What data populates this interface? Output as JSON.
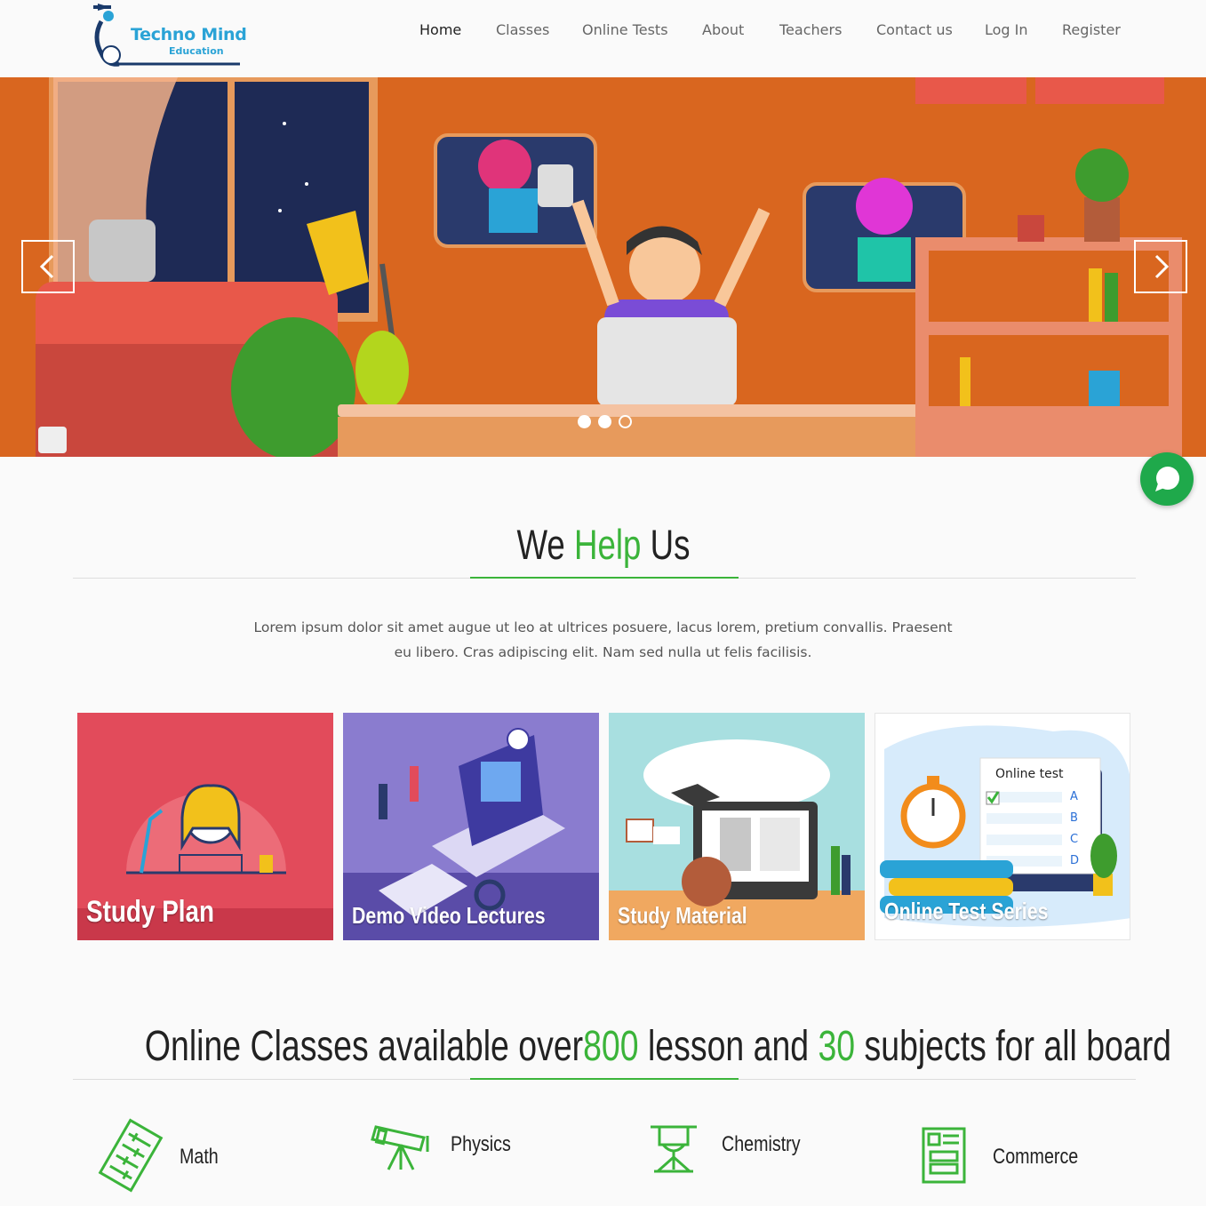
{
  "header": {
    "logo_text": "Techno Mind",
    "logo_sub": "Education",
    "nav": [
      "Home",
      "Classes",
      "Online Tests",
      "About",
      "Teachers",
      "Contact us",
      "Log In",
      "Register"
    ]
  },
  "hero": {
    "slide_count": 3,
    "active_slide": 1,
    "prev_icon": "chevron-left-icon",
    "next_icon": "chevron-right-icon"
  },
  "help": {
    "title_pre": "We ",
    "title_accent": "Help",
    "title_post": " Us",
    "intro": "Lorem ipsum dolor sit amet augue ut leo at ultrices posuere, lacus lorem, pretium convallis. Praesent eu libero. Cras adipiscing elit. Nam sed nulla ut felis facilisis."
  },
  "cards": [
    {
      "label": "Study Plan"
    },
    {
      "label": "Demo Video Lectures"
    },
    {
      "label": "Study Material"
    },
    {
      "label": "Online Test Series",
      "test_title": "Online test",
      "options": [
        "A",
        "B",
        "C",
        "D"
      ]
    }
  ],
  "classes": {
    "title_a": "Online Classes available over",
    "num1": "800",
    "title_b": " lesson and ",
    "num2": "30",
    "title_c": " subjects for all board"
  },
  "subjects": [
    {
      "label": "Math",
      "icon": "abacus-icon"
    },
    {
      "label": "Physics",
      "icon": "telescope-icon"
    },
    {
      "label": "Chemistry",
      "icon": "easel-icon"
    },
    {
      "label": "Commerce",
      "icon": "document-icon"
    }
  ],
  "colors": {
    "accent": "#3bb43a",
    "hero_bg": "#d9661f",
    "logo": "#2aa3d6",
    "chat": "#1fa94b"
  }
}
